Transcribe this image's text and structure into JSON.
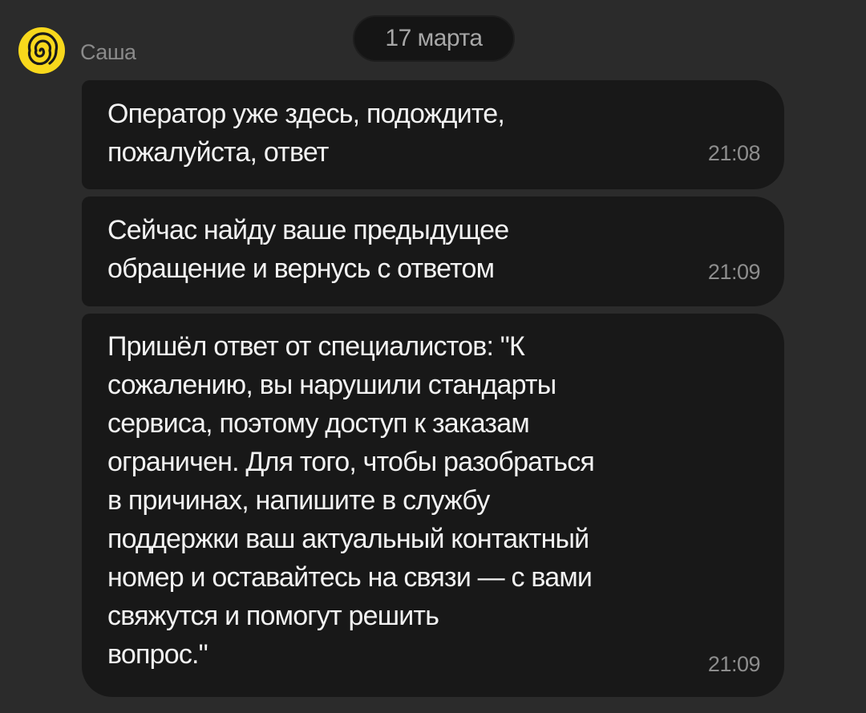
{
  "chat": {
    "sender": {
      "name": "Саша",
      "avatar_icon": "yandex-spiral-icon",
      "avatar_color": "#f8d81c"
    },
    "date_separator": "17 марта",
    "messages": [
      {
        "text": "Оператор уже здесь, подождите,\nпожалуйста, ответ",
        "time": "21:08"
      },
      {
        "text": "Сейчас найду ваше предыдущее\nобращение и вернусь с ответом",
        "time": "21:09"
      },
      {
        "text": "Пришёл ответ от специалистов: \"К\nсожалению, вы нарушили стандарты\nсервиса, поэтому доступ к заказам\nограничен. Для того, чтобы разобраться\nв причинах, напишите в службу\nподдержки ваш актуальный контактный\nномер и оставайтесь на связи — с вами\nсвяжутся и помогут решить\nвопрос.\"",
        "time": "21:09"
      }
    ]
  },
  "colors": {
    "background": "#2b2b2b",
    "bubble": "#181818",
    "date_pill": "#151515",
    "message_text": "#f2f2f2",
    "timestamp": "#8d8d8d"
  }
}
